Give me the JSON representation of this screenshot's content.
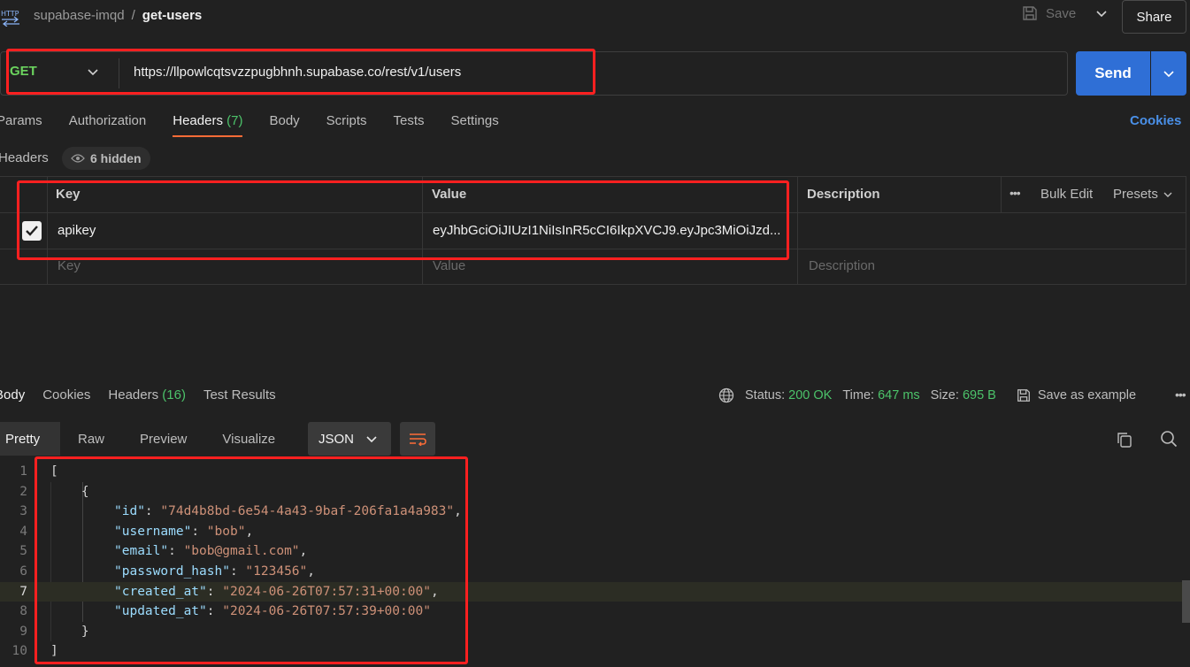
{
  "header": {
    "workspace": "supabase-imqd",
    "separator": "/",
    "request_name": "get-users",
    "save_label": "Save",
    "share_label": "Share"
  },
  "request": {
    "method": "GET",
    "url": "https://llpowlcqtsvzzpugbhnh.supabase.co/rest/v1/users",
    "send_label": "Send"
  },
  "request_tabs": [
    {
      "label": "Params"
    },
    {
      "label": "Authorization"
    },
    {
      "label": "Headers",
      "count": "(7)"
    },
    {
      "label": "Body"
    },
    {
      "label": "Scripts"
    },
    {
      "label": "Tests"
    },
    {
      "label": "Settings"
    }
  ],
  "cookies_label": "Cookies",
  "headers_section": {
    "label": "Headers",
    "hidden_label": "6 hidden",
    "columns": {
      "key": "Key",
      "value": "Value",
      "description": "Description"
    },
    "bulk_edit": "Bulk Edit",
    "presets": "Presets",
    "rows": [
      {
        "checked": true,
        "key": "apikey",
        "value": "eyJhbGciOiJIUzI1NiIsInR5cCI6IkpXVCJ9.eyJpc3MiOiJzd..."
      }
    ],
    "placeholders": {
      "key": "Key",
      "value": "Value",
      "description": "Description"
    }
  },
  "response_tabs": [
    {
      "label": "Body"
    },
    {
      "label": "Cookies"
    },
    {
      "label": "Headers",
      "count": "(16)"
    },
    {
      "label": "Test Results"
    }
  ],
  "response_meta": {
    "status_label": "Status:",
    "status": "200 OK",
    "time_label": "Time:",
    "time": "647 ms",
    "size_label": "Size:",
    "size": "695 B",
    "save_example": "Save as example"
  },
  "view_tabs": [
    {
      "label": "Pretty"
    },
    {
      "label": "Raw"
    },
    {
      "label": "Preview"
    },
    {
      "label": "Visualize"
    }
  ],
  "format": "JSON",
  "code_lines": [
    {
      "n": "1",
      "text": "["
    },
    {
      "n": "2",
      "text": "    {"
    },
    {
      "n": "3",
      "key": "\"id\"",
      "value": "\"74d4b8bd-6e54-4a43-9baf-206fa1a4a983\"",
      "tail": ","
    },
    {
      "n": "4",
      "key": "\"username\"",
      "value": "\"bob\"",
      "tail": ","
    },
    {
      "n": "5",
      "key": "\"email\"",
      "value": "\"bob@gmail.com\"",
      "tail": ","
    },
    {
      "n": "6",
      "key": "\"password_hash\"",
      "value": "\"123456\"",
      "tail": ","
    },
    {
      "n": "7",
      "key": "\"created_at\"",
      "value": "\"2024-06-26T07:57:31+00:00\"",
      "tail": ","
    },
    {
      "n": "8",
      "key": "\"updated_at\"",
      "value": "\"2024-06-26T07:57:39+00:00\"",
      "tail": ""
    },
    {
      "n": "9",
      "text": "    }"
    },
    {
      "n": "10",
      "text": "]"
    }
  ],
  "colors": {
    "accent": "#ff6c37",
    "send": "#2f6fd6",
    "method_get": "#6bd35e",
    "status_ok": "#4cc36a",
    "annotation": "#ff2020"
  }
}
